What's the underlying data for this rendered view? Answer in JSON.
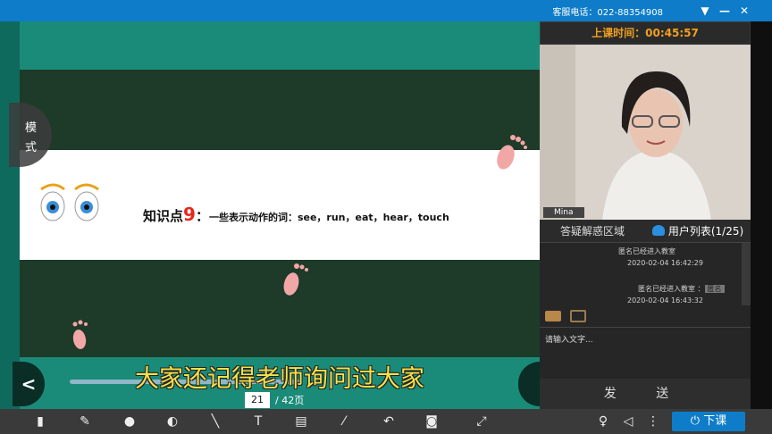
{
  "titlebar": {
    "phone": "客服电话：022-88354908",
    "buttons": [
      "▼",
      "—",
      "✕"
    ]
  },
  "slide": {
    "mode_label_1": "模",
    "mode_label_2": "式",
    "title_prefix": "知识点",
    "title_number": "9",
    "title_colon": "：",
    "title_rest": "一些表示动作的词：see，run，eat，hear，touch",
    "subtitle": "大家还记得老师询问过大家",
    "page_current": "21",
    "page_total": "/  42页",
    "progress": 0.5
  },
  "right_panel": {
    "timer": "上课时间：00:45:57",
    "participant_name": "Mina",
    "tabs": [
      "答疑解惑区域",
      "用户列表(1/25)"
    ],
    "chat": [
      {
        "text": "匿名已经进入教室",
        "time": "2020-02-04  16:42:29"
      },
      {
        "text": "匿名已经进入教室",
        "tag": "匿名",
        "time": "2020-02-04  16:43:32"
      }
    ],
    "input_placeholder": "请输入文字...",
    "send_label": "发   送"
  },
  "toolbar": {
    "class_button": "下课",
    "tools": [
      "mouse",
      "pen",
      "eraser",
      "palette",
      "line",
      "text",
      "trash",
      "highlighter",
      "undo",
      "camera",
      "fullscreen",
      "mic",
      "speaker",
      "equalizer"
    ]
  },
  "colors": {
    "accent": "#0e7cc8",
    "teal": "#1b8b79",
    "board": "#1e3a28",
    "timer": "#f0a020",
    "highlight": "#e5281c",
    "subtitle": "#f4e24a"
  }
}
